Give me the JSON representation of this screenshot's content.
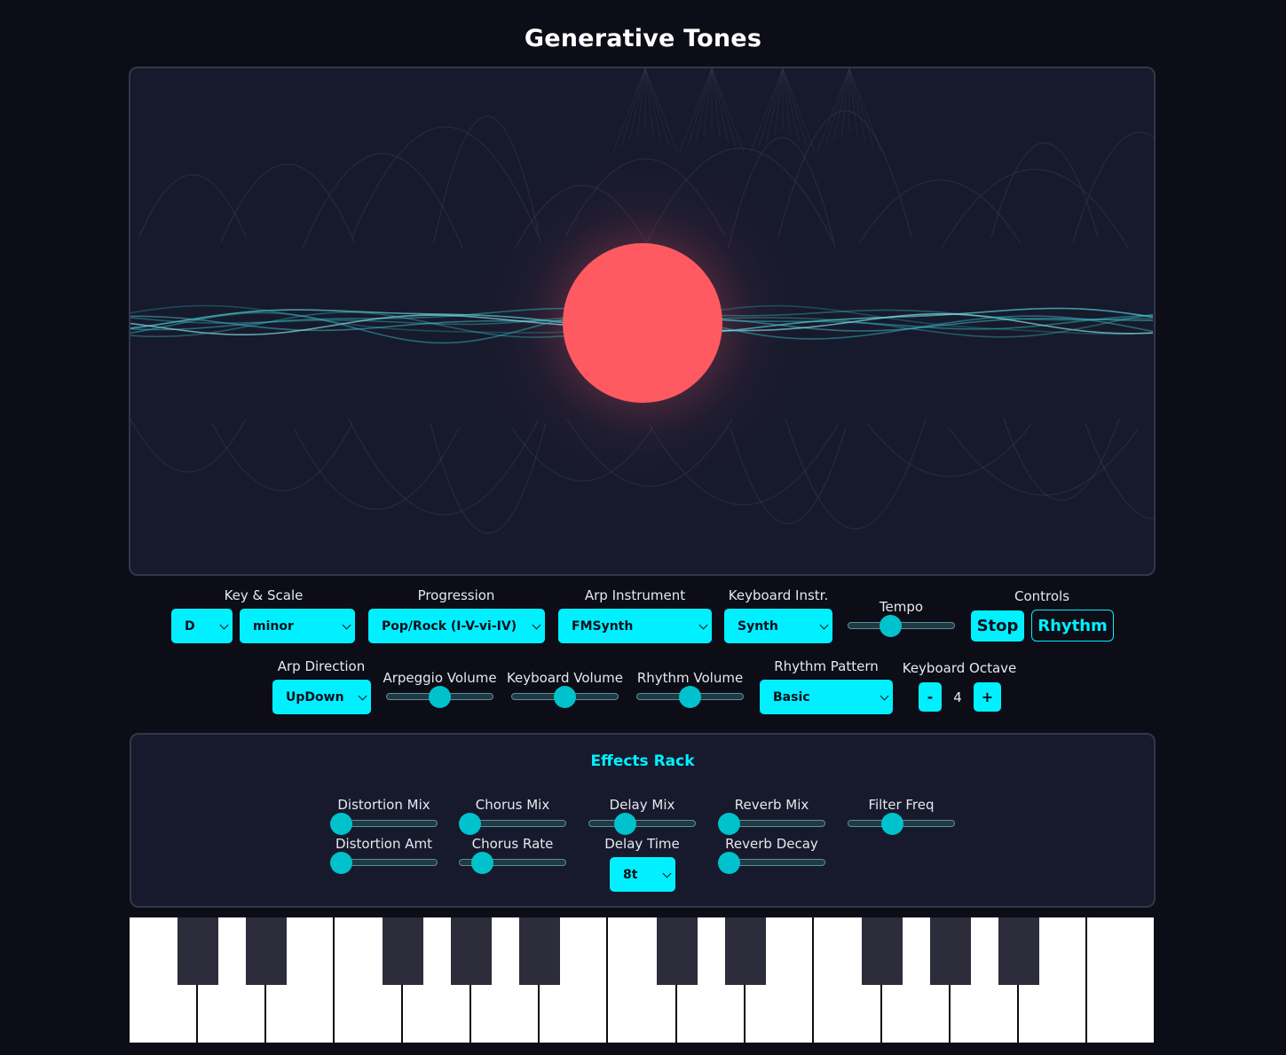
{
  "app": {
    "title": "Generative Tones"
  },
  "colors": {
    "accent": "#00f0ff",
    "background": "#0c0d16",
    "panel": "#171a2c",
    "orb": "#ff5a62",
    "wave": "#3fd0d8"
  },
  "controls": {
    "key_scale_label": "Key & Scale",
    "key_value": "D",
    "scale_value": "minor",
    "progression_label": "Progression",
    "progression_value": "Pop/Rock (I-V-vi-IV)",
    "arp_instrument_label": "Arp Instrument",
    "arp_instrument_value": "FMSynth",
    "keyboard_instr_label": "Keyboard Instr.",
    "keyboard_instr_value": "Synth",
    "tempo_label": "Tempo",
    "tempo_level": 0.37,
    "controls_label": "Controls",
    "stop_label": "Stop",
    "rhythm_label": "Rhythm",
    "arp_direction_label": "Arp Direction",
    "arp_direction_value": "UpDown",
    "arpeggio_volume_label": "Arpeggio Volume",
    "arpeggio_volume_level": 0.5,
    "keyboard_volume_label": "Keyboard Volume",
    "keyboard_volume_level": 0.5,
    "rhythm_volume_label": "Rhythm Volume",
    "rhythm_volume_level": 0.5,
    "rhythm_pattern_label": "Rhythm Pattern",
    "rhythm_pattern_value": "Basic",
    "keyboard_octave_label": "Keyboard Octave",
    "octave_minus_label": "-",
    "octave_value": "4",
    "octave_plus_label": "+"
  },
  "effects": {
    "title": "Effects Rack",
    "distortion_mix_label": "Distortion Mix",
    "distortion_mix_level": 0.0,
    "chorus_mix_label": "Chorus Mix",
    "chorus_mix_level": 0.0,
    "delay_mix_label": "Delay Mix",
    "delay_mix_level": 0.3,
    "reverb_mix_label": "Reverb Mix",
    "reverb_mix_level": 0.0,
    "filter_freq_label": "Filter Freq",
    "filter_freq_level": 0.4,
    "distortion_amt_label": "Distortion Amt",
    "distortion_amt_level": 0.0,
    "chorus_rate_label": "Chorus Rate",
    "chorus_rate_level": 0.15,
    "delay_time_label": "Delay Time",
    "delay_time_value": "8t",
    "reverb_decay_label": "Reverb Decay",
    "reverb_decay_level": 0.0
  }
}
